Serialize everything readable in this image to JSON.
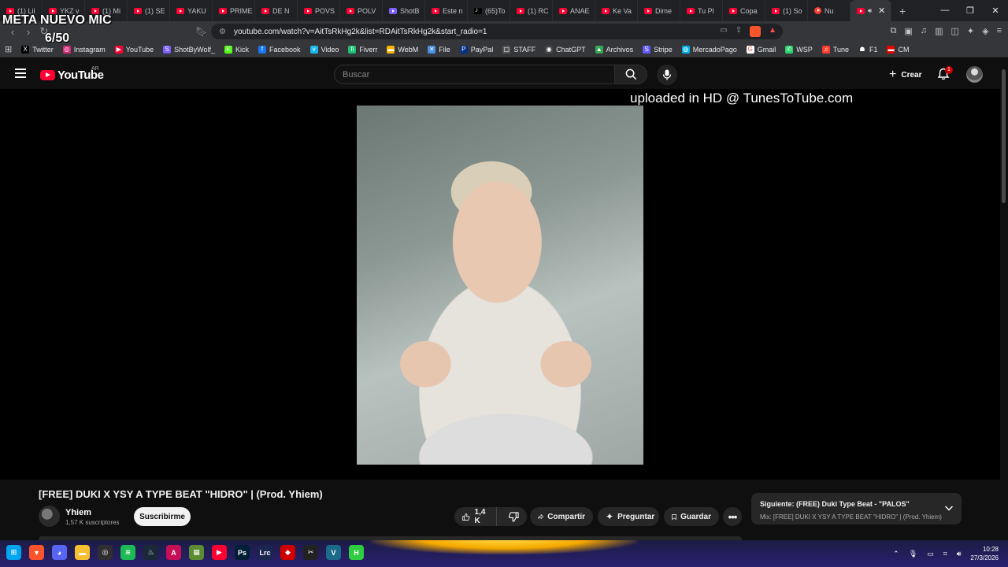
{
  "overlay": {
    "title": "META NUEVO MIC",
    "count": "6/50"
  },
  "browser": {
    "tabs": [
      {
        "label": "(1) Lil",
        "icon": "youtube"
      },
      {
        "label": "YKZ v",
        "icon": "youtube"
      },
      {
        "label": "(1) Mi",
        "icon": "youtube"
      },
      {
        "label": "(1) SE",
        "icon": "youtube"
      },
      {
        "label": "YAKU",
        "icon": "youtube"
      },
      {
        "label": "PRIME",
        "icon": "youtube"
      },
      {
        "label": "DE N",
        "icon": "youtube"
      },
      {
        "label": "POVS",
        "icon": "youtube"
      },
      {
        "label": "POLV",
        "icon": "youtube"
      },
      {
        "label": "ShotB",
        "icon": "shotbywolf"
      },
      {
        "label": "Este n",
        "icon": "youtube"
      },
      {
        "label": "(65)To",
        "icon": "tiktok"
      },
      {
        "label": "(1) RC",
        "icon": "youtube"
      },
      {
        "label": "ANAE",
        "icon": "youtube"
      },
      {
        "label": "Ke Va",
        "icon": "youtube"
      },
      {
        "label": "Dime",
        "icon": "youtube"
      },
      {
        "label": "Tu Pl",
        "icon": "youtube"
      },
      {
        "label": "Copa",
        "icon": "youtube"
      },
      {
        "label": "(1) So",
        "icon": "youtube"
      },
      {
        "label": "Nu",
        "icon": "record"
      }
    ],
    "url": "youtube.com/watch?v=AitTsRkHg2k&list=RDAitTsRkHg2k&start_radio=1",
    "bookmarks": [
      {
        "label": "Twitter",
        "color": "#000000",
        "glyph": "X"
      },
      {
        "label": "Instagram",
        "color": "#d62976",
        "glyph": "◎"
      },
      {
        "label": "YouTube",
        "color": "#ff0033",
        "glyph": "▶"
      },
      {
        "label": "ShotByWolf_",
        "color": "#7b5cff",
        "glyph": "S"
      },
      {
        "label": "Kick",
        "color": "#53fc18",
        "glyph": "K"
      },
      {
        "label": "Facebook",
        "color": "#1877f2",
        "glyph": "f"
      },
      {
        "label": "Video",
        "color": "#1ab7ea",
        "glyph": "v"
      },
      {
        "label": "Fiverr",
        "color": "#1dbf73",
        "glyph": "fi"
      },
      {
        "label": "WebM",
        "color": "#f4b400",
        "glyph": "▬"
      },
      {
        "label": "File",
        "color": "#4a90e2",
        "glyph": "✕"
      },
      {
        "label": "PayPal",
        "color": "#003087",
        "glyph": "P"
      },
      {
        "label": "STAFF",
        "color": "#555555",
        "glyph": "▢"
      },
      {
        "label": "ChatGPT",
        "color": "#444444",
        "glyph": "◉"
      },
      {
        "label": "Archivos",
        "color": "#34a853",
        "glyph": "▲"
      },
      {
        "label": "Stripe",
        "color": "#635bff",
        "glyph": "S"
      },
      {
        "label": "MercadoPago",
        "color": "#00b1ea",
        "glyph": "◍"
      },
      {
        "label": "Gmail",
        "color": "#ffffff",
        "glyph": "G"
      },
      {
        "label": "WSP",
        "color": "#25d366",
        "glyph": "✆"
      },
      {
        "label": "Tune",
        "color": "#ff3b30",
        "glyph": "♫"
      },
      {
        "label": "F1",
        "color": "#333333",
        "glyph": "☗"
      },
      {
        "label": "CM",
        "color": "#e10600",
        "glyph": "▬"
      }
    ]
  },
  "youtube": {
    "logo_text": "YouTube",
    "country": "AR",
    "search_placeholder": "Buscar",
    "create_label": "Crear",
    "notification_count": "1",
    "watermark": "uploaded in HD @ TunesToTube.com",
    "video": {
      "title": "[FREE] DUKI X YSY A TYPE BEAT \"HIDRO\" | (Prod. Yhiem)",
      "channel": "Yhiem",
      "subscribers": "1,57 K suscriptores",
      "subscribe_label": "Suscribirme",
      "likes": "1,4 K",
      "share_label": "Compartir",
      "ask_label": "Preguntar",
      "save_label": "Guardar"
    },
    "next": {
      "line1": "Siguiente: (FREE) Duki Type Beat - \"PALOS\"",
      "line2": "Mix: [FREE] DUKI X YSY A TYPE BEAT \"HIDRO\" | (Prod. Yhiem)"
    }
  },
  "taskbar": {
    "apps": [
      {
        "name": "windows-start",
        "color": "#00a4ef",
        "glyph": "⊞"
      },
      {
        "name": "brave",
        "color": "#fb542b",
        "glyph": "▼"
      },
      {
        "name": "discord",
        "color": "#5865f2",
        "glyph": "◕"
      },
      {
        "name": "file-explorer",
        "color": "#f8c030",
        "glyph": "▬"
      },
      {
        "name": "obs",
        "color": "#302e31",
        "glyph": "◎"
      },
      {
        "name": "spotify",
        "color": "#1db954",
        "glyph": "≋"
      },
      {
        "name": "steam",
        "color": "#1b2838",
        "glyph": "♨"
      },
      {
        "name": "adobe",
        "color": "#c70f58",
        "glyph": "A"
      },
      {
        "name": "minecraft",
        "color": "#5b8b32",
        "glyph": "▦"
      },
      {
        "name": "youtube-app",
        "color": "#ff0033",
        "glyph": "▶"
      },
      {
        "name": "photoshop",
        "color": "#001e36",
        "glyph": "Ps"
      },
      {
        "name": "lrc",
        "color": "#1a2550",
        "glyph": "Lrc"
      },
      {
        "name": "redbull",
        "color": "#d10000",
        "glyph": "◆"
      },
      {
        "name": "capcut",
        "color": "#222222",
        "glyph": "✂"
      },
      {
        "name": "valorant",
        "color": "#1a6b8a",
        "glyph": "V"
      },
      {
        "name": "h-app",
        "color": "#2ecc40",
        "glyph": "H"
      }
    ],
    "time": "10:28",
    "date": "27/3/2026"
  }
}
